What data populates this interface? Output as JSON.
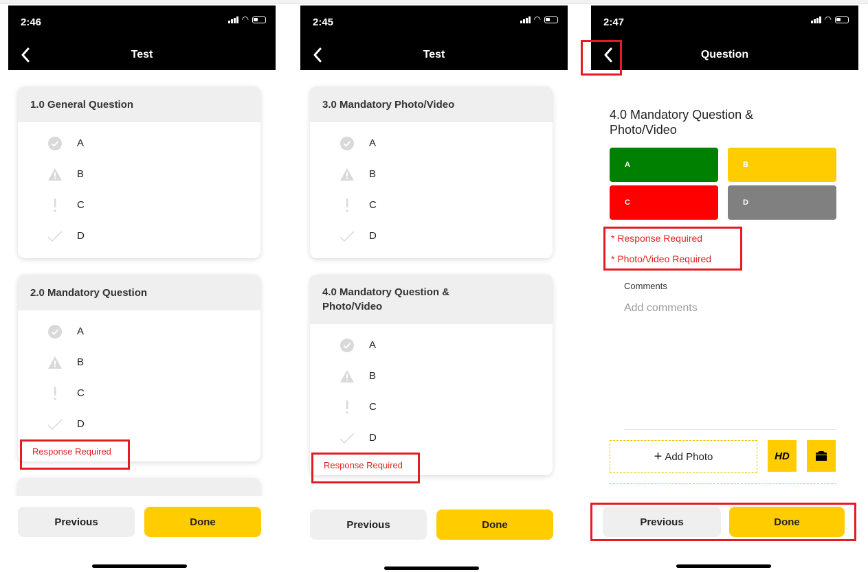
{
  "colors": {
    "accent_yellow": "#ffcc00",
    "error_red": "#e02020",
    "highlight_red": "#e51b23",
    "header_black": "#000000",
    "resp_green": "#008000",
    "resp_yellow": "#ffcc00",
    "resp_red": "#ff0000",
    "resp_gray": "#808080"
  },
  "screens": [
    {
      "time": "2:46",
      "title": "Test",
      "cards": [
        {
          "header": "1.0 General Question",
          "options": [
            {
              "label": "A",
              "icon": "check-circle-icon"
            },
            {
              "label": "B",
              "icon": "warning-triangle-icon"
            },
            {
              "label": "C",
              "icon": "exclamation-icon"
            },
            {
              "label": "D",
              "icon": "checkmark-icon"
            }
          ]
        },
        {
          "header": "2.0 Mandatory Question",
          "options": [
            {
              "label": "A",
              "icon": "check-circle-icon"
            },
            {
              "label": "B",
              "icon": "warning-triangle-icon"
            },
            {
              "label": "C",
              "icon": "exclamation-icon"
            },
            {
              "label": "D",
              "icon": "checkmark-icon"
            }
          ],
          "error": "Response Required"
        }
      ],
      "footer": {
        "previous": "Previous",
        "done": "Done"
      }
    },
    {
      "time": "2:45",
      "title": "Test",
      "cards": [
        {
          "header": "3.0 Mandatory Photo/Video",
          "options": [
            {
              "label": "A",
              "icon": "check-circle-icon"
            },
            {
              "label": "B",
              "icon": "warning-triangle-icon"
            },
            {
              "label": "C",
              "icon": "exclamation-icon"
            },
            {
              "label": "D",
              "icon": "checkmark-icon"
            }
          ]
        },
        {
          "header": "4.0 Mandatory Question &\nPhoto/Video",
          "options": [
            {
              "label": "A",
              "icon": "check-circle-icon"
            },
            {
              "label": "B",
              "icon": "warning-triangle-icon"
            },
            {
              "label": "C",
              "icon": "exclamation-icon"
            },
            {
              "label": "D",
              "icon": "checkmark-icon"
            }
          ],
          "error": "Response Required"
        }
      ],
      "footer": {
        "previous": "Previous",
        "done": "Done"
      }
    },
    {
      "time": "2:47",
      "title": "Question",
      "question_title": "4.0 Mandatory Question &\nPhoto/Video",
      "responses": [
        {
          "label": "A",
          "color": "#008000"
        },
        {
          "label": "B",
          "color": "#ffcc00"
        },
        {
          "label": "C",
          "color": "#ff0000"
        },
        {
          "label": "D",
          "color": "#808080"
        }
      ],
      "errors": [
        "* Response Required",
        "* Photo/Video Required"
      ],
      "comments_label": "Comments",
      "comments_placeholder": "Add comments",
      "add_photo": "Add Photo",
      "add_photo_plus": "+",
      "hd_label": "HD",
      "footer": {
        "previous": "Previous",
        "done": "Done"
      }
    }
  ]
}
